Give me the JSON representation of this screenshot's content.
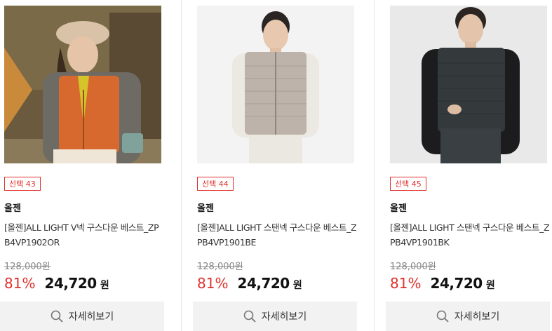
{
  "products": [
    {
      "badge": "선택 43",
      "brand": "올젠",
      "name": "[올젠]ALL LIGHT V넥 구스다운 베스트_ZPB4VP1902OR",
      "original_price": "128,000원",
      "discount": "81%",
      "price": "24,720",
      "currency": "원",
      "detail_label": "자세히보기"
    },
    {
      "badge": "선택 44",
      "brand": "올젠",
      "name": "[올젠]ALL LIGHT 스탠넥 구스다운 베스트_ZPB4VP1901BE",
      "original_price": "128,000원",
      "discount": "81%",
      "price": "24,720",
      "currency": "원",
      "detail_label": "자세히보기"
    },
    {
      "badge": "선택 45",
      "brand": "올젠",
      "name": "[올젠]ALL LIGHT 스탠넥 구스다운 베스트_ZPB4VP1901BK",
      "original_price": "128,000원",
      "discount": "81%",
      "price": "24,720",
      "currency": "원",
      "detail_label": "자세히보기"
    }
  ],
  "colors": {
    "accent": "#e0312c",
    "button_bg": "#f2f2f2"
  }
}
